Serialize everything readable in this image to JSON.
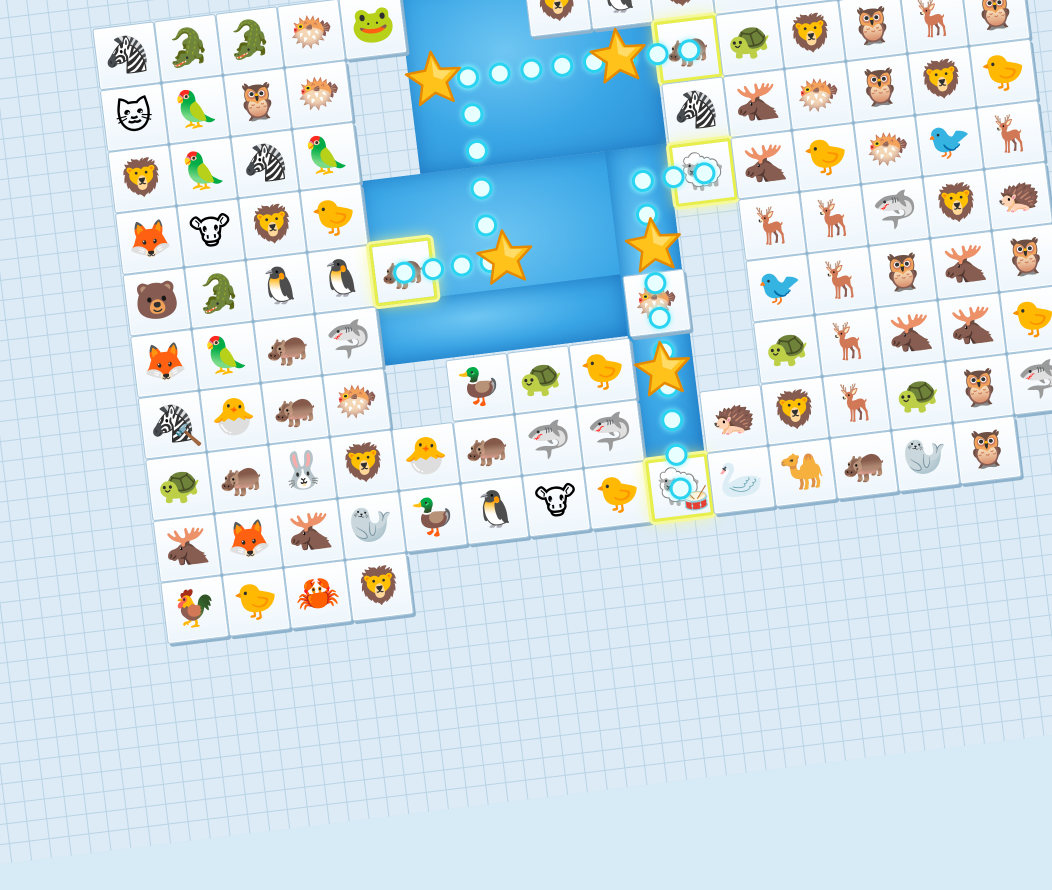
{
  "game": {
    "type": "onet-connect-animal-match",
    "accent_path_color": "#2ad4f0",
    "selection_color": "#e8ef4b",
    "star_color": "#ffc21a"
  },
  "tiles": [
    {
      "id": "r0c0",
      "row": 0,
      "col": 0,
      "animal": "zebra",
      "glyph": "🦓"
    },
    {
      "id": "r0c1",
      "row": 0,
      "col": 1,
      "animal": "crocodile",
      "glyph": "🐊"
    },
    {
      "id": "r0c2",
      "row": 0,
      "col": 2,
      "animal": "crocodile",
      "glyph": "🐊"
    },
    {
      "id": "r0c3",
      "row": 0,
      "col": 3,
      "animal": "fish",
      "glyph": "🐡"
    },
    {
      "id": "r0c4",
      "row": 0,
      "col": 4,
      "animal": "frog",
      "glyph": "🐸"
    },
    {
      "id": "r0c7",
      "row": 0,
      "col": 7,
      "animal": "lion",
      "glyph": "🦁"
    },
    {
      "id": "r0c8",
      "row": 0,
      "col": 8,
      "animal": "penguin",
      "glyph": "🐧"
    },
    {
      "id": "r0c9",
      "row": 0,
      "col": 9,
      "animal": "lion",
      "glyph": "🦁"
    },
    {
      "id": "r0c10",
      "row": 0,
      "col": 10,
      "animal": "turtle",
      "glyph": "🐢"
    },
    {
      "id": "r0c11",
      "row": 0,
      "col": 11,
      "animal": "monkey",
      "glyph": "🐒"
    },
    {
      "id": "r0c12",
      "row": 0,
      "col": 12,
      "animal": "owl",
      "glyph": "🦉"
    },
    {
      "id": "r0c13",
      "row": 0,
      "col": 13,
      "animal": "deer",
      "glyph": "🦌"
    },
    {
      "id": "r0c14",
      "row": 0,
      "col": 14,
      "animal": "turtle",
      "glyph": "🐢"
    },
    {
      "id": "r1c0",
      "row": 1,
      "col": 0,
      "animal": "cat",
      "glyph": "🐱"
    },
    {
      "id": "r1c1",
      "row": 1,
      "col": 1,
      "animal": "parrot",
      "glyph": "🦜"
    },
    {
      "id": "r1c2",
      "row": 1,
      "col": 2,
      "animal": "owl",
      "glyph": "🦉"
    },
    {
      "id": "r1c3",
      "row": 1,
      "col": 3,
      "animal": "fish",
      "glyph": "🐡"
    },
    {
      "id": "r1c9",
      "row": 1,
      "col": 9,
      "animal": "hippo",
      "glyph": "🦛",
      "selected": true
    },
    {
      "id": "r1c10",
      "row": 1,
      "col": 10,
      "animal": "turtle",
      "glyph": "🐢"
    },
    {
      "id": "r1c11",
      "row": 1,
      "col": 11,
      "animal": "lion",
      "glyph": "🦁"
    },
    {
      "id": "r1c12",
      "row": 1,
      "col": 12,
      "animal": "owl",
      "glyph": "🦉"
    },
    {
      "id": "r1c13",
      "row": 1,
      "col": 13,
      "animal": "deer",
      "glyph": "🦌"
    },
    {
      "id": "r1c14",
      "row": 1,
      "col": 14,
      "animal": "owl",
      "glyph": "🦉"
    },
    {
      "id": "r2c0",
      "row": 2,
      "col": 0,
      "animal": "lion",
      "glyph": "🦁"
    },
    {
      "id": "r2c1",
      "row": 2,
      "col": 1,
      "animal": "parrot",
      "glyph": "🦜"
    },
    {
      "id": "r2c2",
      "row": 2,
      "col": 2,
      "animal": "zebra",
      "glyph": "🦓"
    },
    {
      "id": "r2c3",
      "row": 2,
      "col": 3,
      "animal": "parrot",
      "glyph": "🦜"
    },
    {
      "id": "r2c9",
      "row": 2,
      "col": 9,
      "animal": "zebra",
      "glyph": "🦓"
    },
    {
      "id": "r2c10",
      "row": 2,
      "col": 10,
      "animal": "moose",
      "glyph": "🫎"
    },
    {
      "id": "r2c11",
      "row": 2,
      "col": 11,
      "animal": "fish",
      "glyph": "🐡"
    },
    {
      "id": "r2c12",
      "row": 2,
      "col": 12,
      "animal": "owl",
      "glyph": "🦉"
    },
    {
      "id": "r2c13",
      "row": 2,
      "col": 13,
      "animal": "lion",
      "glyph": "🦁"
    },
    {
      "id": "r2c14",
      "row": 2,
      "col": 14,
      "animal": "chick",
      "glyph": "🐤"
    },
    {
      "id": "r3c0",
      "row": 3,
      "col": 0,
      "animal": "fox",
      "glyph": "🦊"
    },
    {
      "id": "r3c1",
      "row": 3,
      "col": 1,
      "animal": "cow",
      "glyph": "🐮"
    },
    {
      "id": "r3c2",
      "row": 3,
      "col": 2,
      "animal": "lion",
      "glyph": "🦁"
    },
    {
      "id": "r3c3",
      "row": 3,
      "col": 3,
      "animal": "chick",
      "glyph": "🐤"
    },
    {
      "id": "r3c9",
      "row": 3,
      "col": 9,
      "animal": "sheep",
      "glyph": "🐑",
      "selected": true
    },
    {
      "id": "r3c10",
      "row": 3,
      "col": 10,
      "animal": "moose",
      "glyph": "🫎"
    },
    {
      "id": "r3c11",
      "row": 3,
      "col": 11,
      "animal": "chick",
      "glyph": "🐤"
    },
    {
      "id": "r3c12",
      "row": 3,
      "col": 12,
      "animal": "fish",
      "glyph": "🐡"
    },
    {
      "id": "r3c13",
      "row": 3,
      "col": 13,
      "animal": "bird",
      "glyph": "🐦"
    },
    {
      "id": "r3c14",
      "row": 3,
      "col": 14,
      "animal": "deer",
      "glyph": "🦌"
    },
    {
      "id": "r4c0",
      "row": 4,
      "col": 0,
      "animal": "bear",
      "glyph": "🐻"
    },
    {
      "id": "r4c1",
      "row": 4,
      "col": 1,
      "animal": "crocodile",
      "glyph": "🐊"
    },
    {
      "id": "r4c2",
      "row": 4,
      "col": 2,
      "animal": "penguin",
      "glyph": "🐧"
    },
    {
      "id": "r4c3",
      "row": 4,
      "col": 3,
      "animal": "penguin",
      "glyph": "🐧"
    },
    {
      "id": "r4c4",
      "row": 4,
      "col": 4,
      "animal": "hippo",
      "glyph": "🦛",
      "selected": true
    },
    {
      "id": "r4c10",
      "row": 4,
      "col": 10,
      "animal": "deer",
      "glyph": "🦌"
    },
    {
      "id": "r4c11",
      "row": 4,
      "col": 11,
      "animal": "deer",
      "glyph": "🦌"
    },
    {
      "id": "r4c12",
      "row": 4,
      "col": 12,
      "animal": "shark",
      "glyph": "🦈"
    },
    {
      "id": "r4c13",
      "row": 4,
      "col": 13,
      "animal": "lion",
      "glyph": "🦁"
    },
    {
      "id": "r4c14",
      "row": 4,
      "col": 14,
      "animal": "hedgehog",
      "glyph": "🦔"
    },
    {
      "id": "r5c0",
      "row": 5,
      "col": 0,
      "animal": "fox",
      "glyph": "🦊"
    },
    {
      "id": "r5c1",
      "row": 5,
      "col": 1,
      "animal": "parrot",
      "glyph": "🦜"
    },
    {
      "id": "r5c2",
      "row": 5,
      "col": 2,
      "animal": "hippo",
      "glyph": "🦛"
    },
    {
      "id": "r5c3",
      "row": 5,
      "col": 3,
      "animal": "shark",
      "glyph": "🦈"
    },
    {
      "id": "r5c8",
      "row": 5,
      "col": 8,
      "animal": "fish",
      "glyph": "🐡"
    },
    {
      "id": "r5c10",
      "row": 5,
      "col": 10,
      "animal": "bird",
      "glyph": "🐦"
    },
    {
      "id": "r5c11",
      "row": 5,
      "col": 11,
      "animal": "deer",
      "glyph": "🦌"
    },
    {
      "id": "r5c12",
      "row": 5,
      "col": 12,
      "animal": "owl",
      "glyph": "🦉"
    },
    {
      "id": "r5c13",
      "row": 5,
      "col": 13,
      "animal": "moose",
      "glyph": "🫎"
    },
    {
      "id": "r5c14",
      "row": 5,
      "col": 14,
      "animal": "owl",
      "glyph": "🦉"
    },
    {
      "id": "r6c0",
      "row": 6,
      "col": 0,
      "animal": "zebra",
      "glyph": "🦓"
    },
    {
      "id": "r6c1",
      "row": 6,
      "col": 1,
      "animal": "chick",
      "glyph": "🐣"
    },
    {
      "id": "r6c2",
      "row": 6,
      "col": 2,
      "animal": "hippo",
      "glyph": "🦛"
    },
    {
      "id": "r6c3",
      "row": 6,
      "col": 3,
      "animal": "fish",
      "glyph": "🐡"
    },
    {
      "id": "r6c5",
      "row": 6,
      "col": 5,
      "animal": "duck",
      "glyph": "🦆"
    },
    {
      "id": "r6c6",
      "row": 6,
      "col": 6,
      "animal": "turtle",
      "glyph": "🐢"
    },
    {
      "id": "r6c7",
      "row": 6,
      "col": 7,
      "animal": "chick",
      "glyph": "🐤"
    },
    {
      "id": "r6c10",
      "row": 6,
      "col": 10,
      "animal": "turtle",
      "glyph": "🐢"
    },
    {
      "id": "r6c11",
      "row": 6,
      "col": 11,
      "animal": "deer",
      "glyph": "🦌"
    },
    {
      "id": "r6c12",
      "row": 6,
      "col": 12,
      "animal": "moose",
      "glyph": "🫎"
    },
    {
      "id": "r6c13",
      "row": 6,
      "col": 13,
      "animal": "moose",
      "glyph": "🫎"
    },
    {
      "id": "r6c14",
      "row": 6,
      "col": 14,
      "animal": "chick",
      "glyph": "🐤"
    },
    {
      "id": "r7c0",
      "row": 7,
      "col": 0,
      "animal": "turtle",
      "glyph": "🐢"
    },
    {
      "id": "r7c1",
      "row": 7,
      "col": 1,
      "animal": "hippo",
      "glyph": "🦛"
    },
    {
      "id": "r7c2",
      "row": 7,
      "col": 2,
      "animal": "rabbit",
      "glyph": "🐰"
    },
    {
      "id": "r7c3",
      "row": 7,
      "col": 3,
      "animal": "lion",
      "glyph": "🦁"
    },
    {
      "id": "r7c4",
      "row": 7,
      "col": 4,
      "animal": "chick",
      "glyph": "🐣"
    },
    {
      "id": "r7c5",
      "row": 7,
      "col": 5,
      "animal": "hippo",
      "glyph": "🦛"
    },
    {
      "id": "r7c6",
      "row": 7,
      "col": 6,
      "animal": "shark",
      "glyph": "🦈"
    },
    {
      "id": "r7c7",
      "row": 7,
      "col": 7,
      "animal": "shark",
      "glyph": "🦈"
    },
    {
      "id": "r7c9",
      "row": 7,
      "col": 9,
      "animal": "hedgehog",
      "glyph": "🦔"
    },
    {
      "id": "r7c10",
      "row": 7,
      "col": 10,
      "animal": "lion",
      "glyph": "🦁"
    },
    {
      "id": "r7c11",
      "row": 7,
      "col": 11,
      "animal": "deer",
      "glyph": "🦌"
    },
    {
      "id": "r7c12",
      "row": 7,
      "col": 12,
      "animal": "turtle",
      "glyph": "🐢"
    },
    {
      "id": "r7c13",
      "row": 7,
      "col": 13,
      "animal": "owl",
      "glyph": "🦉"
    },
    {
      "id": "r7c14",
      "row": 7,
      "col": 14,
      "animal": "shark",
      "glyph": "🦈"
    },
    {
      "id": "r8c0",
      "row": 8,
      "col": 0,
      "animal": "moose",
      "glyph": "🫎"
    },
    {
      "id": "r8c1",
      "row": 8,
      "col": 1,
      "animal": "fox",
      "glyph": "🦊"
    },
    {
      "id": "r8c2",
      "row": 8,
      "col": 2,
      "animal": "moose",
      "glyph": "🫎"
    },
    {
      "id": "r8c3",
      "row": 8,
      "col": 3,
      "animal": "seal",
      "glyph": "🦭"
    },
    {
      "id": "r8c4",
      "row": 8,
      "col": 4,
      "animal": "duck",
      "glyph": "🦆"
    },
    {
      "id": "r8c5",
      "row": 8,
      "col": 5,
      "animal": "penguin",
      "glyph": "🐧"
    },
    {
      "id": "r8c6",
      "row": 8,
      "col": 6,
      "animal": "cow",
      "glyph": "🐮"
    },
    {
      "id": "r8c7",
      "row": 8,
      "col": 7,
      "animal": "chick",
      "glyph": "🐤"
    },
    {
      "id": "r8c8",
      "row": 8,
      "col": 8,
      "animal": "sheep",
      "glyph": "🐑",
      "selected": true
    },
    {
      "id": "r8c9",
      "row": 8,
      "col": 9,
      "animal": "pelican",
      "glyph": "🦢"
    },
    {
      "id": "r8c10",
      "row": 8,
      "col": 10,
      "animal": "camel",
      "glyph": "🐪"
    },
    {
      "id": "r8c11",
      "row": 8,
      "col": 11,
      "animal": "hippo",
      "glyph": "🦛"
    },
    {
      "id": "r8c12",
      "row": 8,
      "col": 12,
      "animal": "seal",
      "glyph": "🦭"
    },
    {
      "id": "r8c13",
      "row": 8,
      "col": 13,
      "animal": "owl",
      "glyph": "🦉"
    },
    {
      "id": "r9c0",
      "row": 9,
      "col": 0,
      "animal": "rooster",
      "glyph": "🐓"
    },
    {
      "id": "r9c1",
      "row": 9,
      "col": 1,
      "animal": "chick",
      "glyph": "🐤"
    },
    {
      "id": "r9c2",
      "row": 9,
      "col": 2,
      "animal": "crab",
      "glyph": "🦀"
    },
    {
      "id": "r9c3",
      "row": 9,
      "col": 3,
      "animal": "lion",
      "glyph": "🦁"
    }
  ],
  "cleared_areas": [
    {
      "id": "clear-top",
      "r0": 0,
      "c0": 5,
      "rows": 3,
      "cols": 4
    },
    {
      "id": "clear-mid",
      "r0": 3,
      "c0": 4,
      "rows": 3,
      "cols": 5
    },
    {
      "id": "clear-right",
      "r0": 3,
      "c0": 8,
      "rows": 5,
      "cols": 1
    },
    {
      "id": "clear-low",
      "r0": 5,
      "c0": 4,
      "rows": 1,
      "cols": 4
    }
  ],
  "paths": [
    {
      "id": "path-hippo",
      "points": [
        [
          4.5,
          4.5
        ],
        [
          4.5,
          5.9
        ],
        [
          1.5,
          5.9
        ],
        [
          1.5,
          9.5
        ]
      ]
    },
    {
      "id": "path-sheep",
      "points": [
        [
          3.5,
          9.5
        ],
        [
          3.5,
          8.5
        ],
        [
          8.5,
          8.5
        ]
      ]
    }
  ],
  "stars": [
    [
      4.5,
      6.2
    ],
    [
      1.5,
      5.4
    ],
    [
      1.5,
      8.4
    ],
    [
      4.6,
      8.6
    ],
    [
      6.6,
      8.5
    ]
  ],
  "tools": [
    {
      "id": "tool-hammer",
      "row": 6,
      "col": 0,
      "glyph": "🔨"
    },
    {
      "id": "tool-drum",
      "row": 8,
      "col": 8,
      "glyph": "🥁"
    }
  ]
}
